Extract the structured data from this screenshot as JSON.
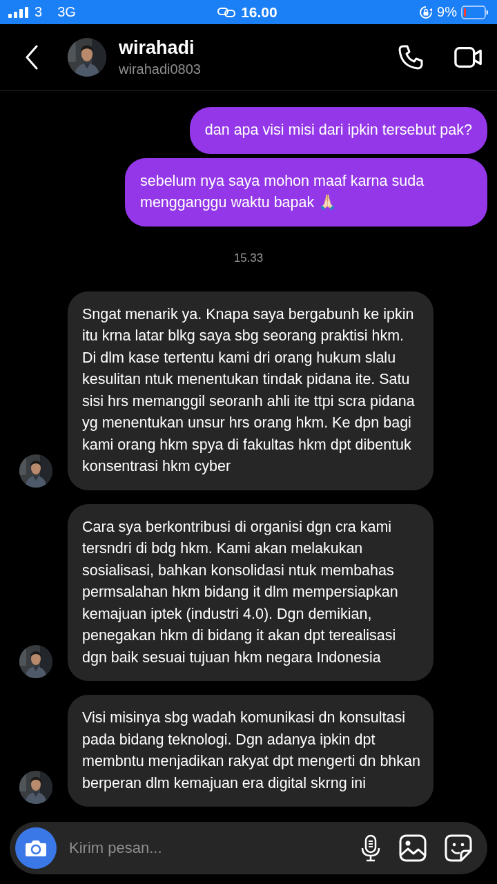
{
  "status_bar": {
    "carrier": "3",
    "network": "3G",
    "time": "16.00",
    "battery": "9%"
  },
  "header": {
    "name": "wirahadi",
    "username": "wirahadi0803"
  },
  "messages": [
    {
      "kind": "sent",
      "text": "dan apa visi misi dari ipkin tersebut pak?"
    },
    {
      "kind": "sent",
      "text": "sebelum nya saya mohon maaf karna suda mengganggu waktu bapak 🙏🏻"
    },
    {
      "kind": "timestamp",
      "text": "15.33"
    },
    {
      "kind": "received",
      "text": "Sngat menarik ya. Knapa saya bergabunh ke ipkin itu krna latar blkg saya sbg seorang praktisi hkm. Di dlm kase tertentu kami dri orang hukum slalu kesulitan ntuk menentukan tindak pidana ite. Satu sisi hrs memanggil seoranh ahli ite ttpi scra pidana yg menentukan unsur hrs orang hkm. Ke dpn bagi kami orang hkm spya di fakultas hkm dpt dibentuk konsentrasi hkm cyber"
    },
    {
      "kind": "received",
      "text": "Cara sya berkontribusi di organisi dgn cra kami tersndri di bdg hkm. Kami akan melakukan sosialisasi, bahkan konsolidasi ntuk membahas permsalahan hkm bidang it dlm mempersiapkan kemajuan iptek (industri 4.0). Dgn demikian, penegakan hkm di bidang it akan dpt terealisasi dgn baik sesuai tujuan hkm negara Indonesia"
    },
    {
      "kind": "received",
      "text": "Visi misinya sbg wadah komunikasi dn konsultasi pada bidang teknologi. Dgn adanya ipkin dpt membntu menjadikan rakyat dpt mengerti dn bhkan berperan dlm kemajuan era digital skrng ini"
    }
  ],
  "composer": {
    "placeholder": "Kirim pesan..."
  }
}
